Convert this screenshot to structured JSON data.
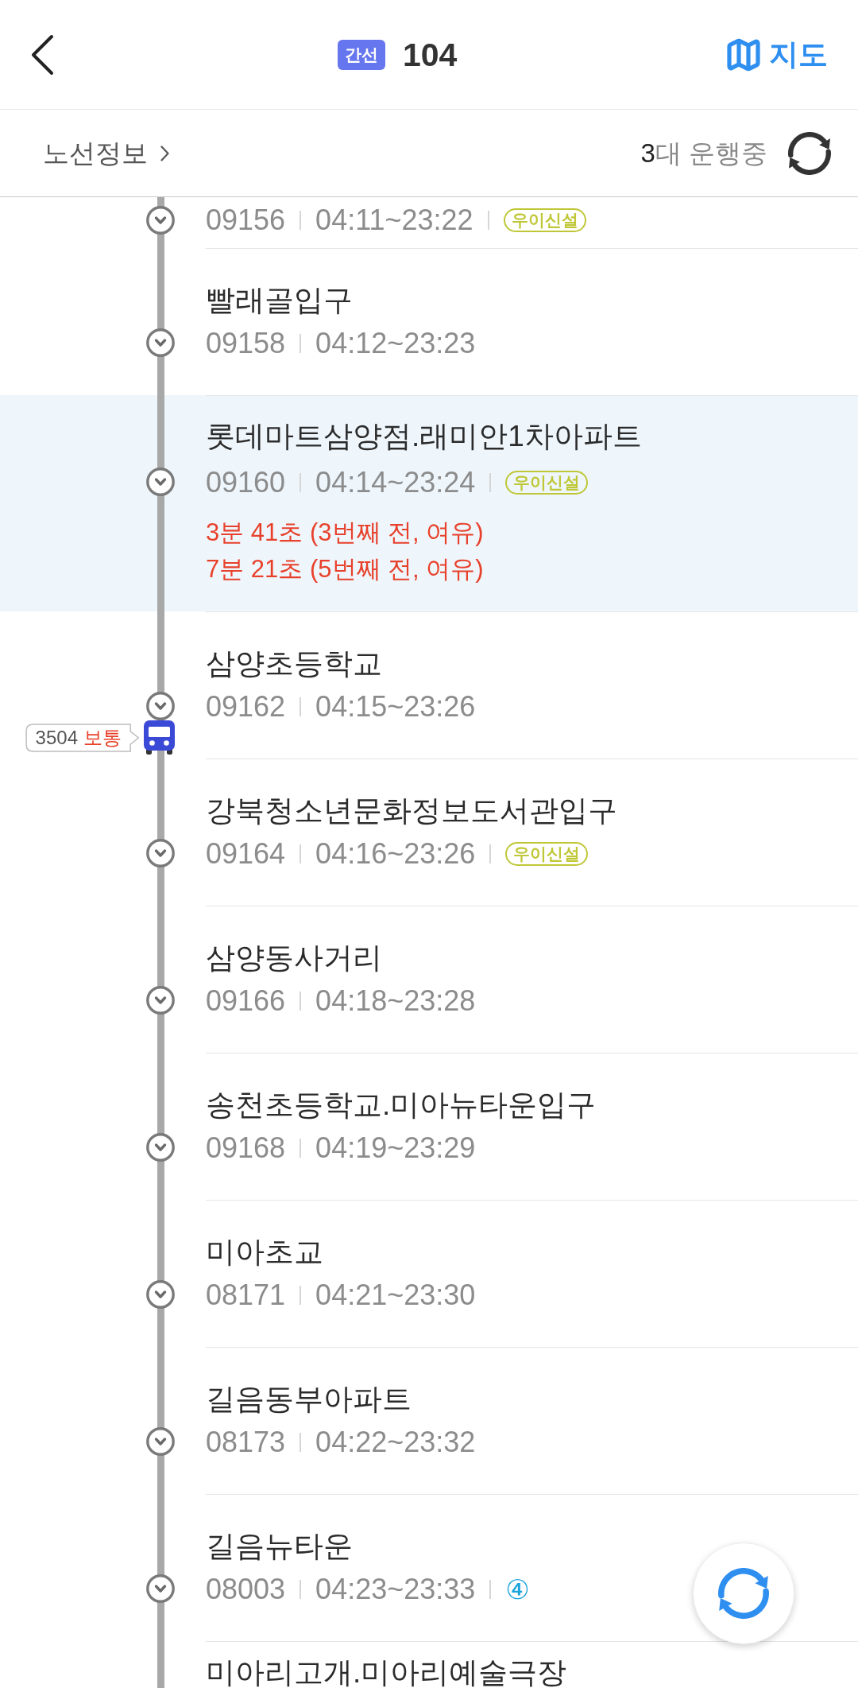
{
  "header": {
    "route_type": "간선",
    "route_number": "104",
    "map_label": "지도"
  },
  "info_bar": {
    "route_info": "노선정보",
    "running_count": "3",
    "running_label": "대 운행중"
  },
  "stops": [
    {
      "code": "09156",
      "hours": "04:11~23:22",
      "tags": [
        {
          "kind": "pill",
          "label": "우이신설",
          "color": "#bfc736"
        }
      ],
      "selected": false
    },
    {
      "name": "빨래골입구",
      "code": "09158",
      "hours": "04:12~23:23",
      "selected": false
    },
    {
      "name": "롯데마트삼양점.래미안1차아파트",
      "code": "09160",
      "hours": "04:14~23:24",
      "tags": [
        {
          "kind": "pill",
          "label": "우이신설",
          "color": "#bfc736"
        }
      ],
      "selected": true,
      "arrivals": [
        "3분 41초 (3번째 전, 여유)",
        "7분 21초 (5번째 전, 여유)"
      ]
    },
    {
      "name": "삼양초등학교",
      "code": "09162",
      "hours": "04:15~23:26",
      "selected": false,
      "bus": {
        "number": "3504",
        "crowding": "보통"
      }
    },
    {
      "name": "강북청소년문화정보도서관입구",
      "code": "09164",
      "hours": "04:16~23:26",
      "tags": [
        {
          "kind": "pill",
          "label": "우이신설",
          "color": "#bfc736"
        }
      ],
      "selected": false
    },
    {
      "name": "삼양동사거리",
      "code": "09166",
      "hours": "04:18~23:28",
      "selected": false
    },
    {
      "name": "송천초등학교.미아뉴타운입구",
      "code": "09168",
      "hours": "04:19~23:29",
      "selected": false
    },
    {
      "name": "미아초교",
      "code": "08171",
      "hours": "04:21~23:30",
      "selected": false
    },
    {
      "name": "길음동부아파트",
      "code": "08173",
      "hours": "04:22~23:32",
      "selected": false
    },
    {
      "name": "길음뉴타운",
      "code": "08003",
      "hours": "04:23~23:33",
      "tags": [
        {
          "kind": "circled",
          "label": "④",
          "color": "#1ba3dc"
        }
      ],
      "selected": false
    },
    {
      "name": "미아리고개.미아리예술극장",
      "selected": false
    }
  ]
}
